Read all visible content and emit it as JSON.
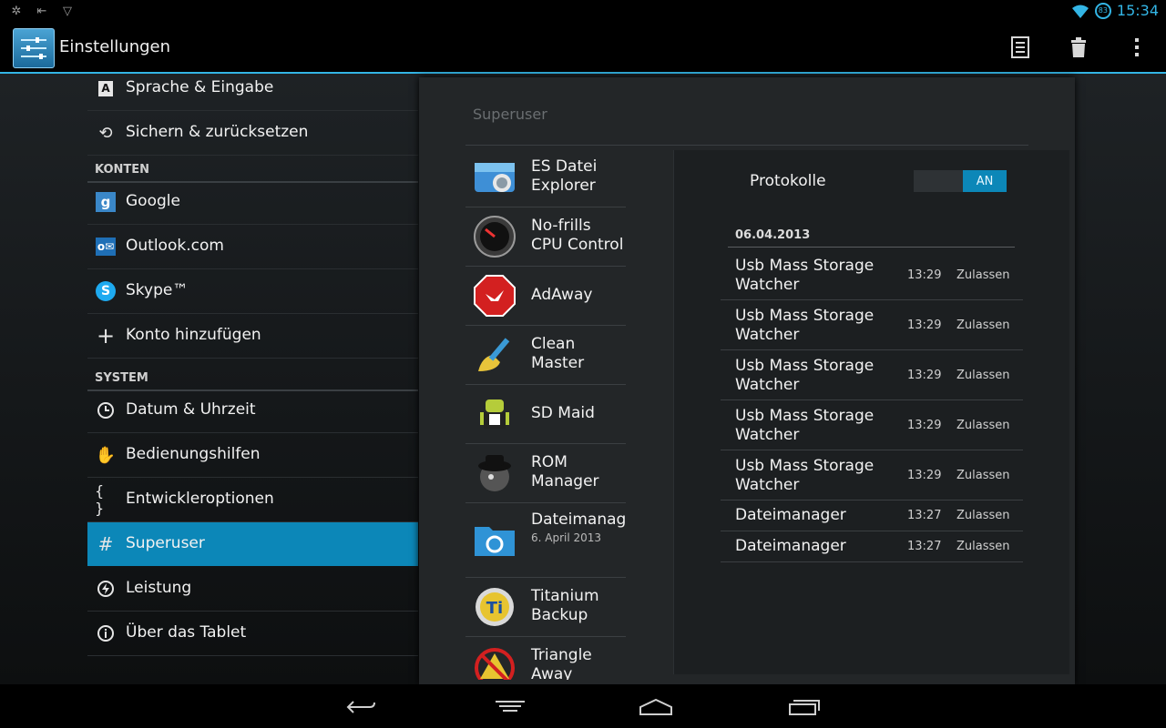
{
  "status": {
    "time": "15:34",
    "battery_label": "83"
  },
  "actionbar": {
    "title": "Einstellungen"
  },
  "settings": {
    "items": [
      {
        "label": "Sprache & Eingabe",
        "icon": "keyboard-a-icon"
      },
      {
        "label": "Sichern & zurücksetzen",
        "icon": "restore-icon"
      },
      {
        "section": "KONTEN"
      },
      {
        "label": "Google",
        "icon": "google-icon"
      },
      {
        "label": "Outlook.com",
        "icon": "outlook-icon"
      },
      {
        "label": "Skype™",
        "icon": "skype-icon"
      },
      {
        "label": "Konto hinzufügen",
        "icon": "plus-icon"
      },
      {
        "section": "SYSTEM"
      },
      {
        "label": "Datum & Uhrzeit",
        "icon": "clock-icon"
      },
      {
        "label": "Bedienungshilfen",
        "icon": "hand-icon"
      },
      {
        "label": "Entwickleroptionen",
        "icon": "braces-icon"
      },
      {
        "label": "Superuser",
        "icon": "hash-icon",
        "selected": true
      },
      {
        "label": "Leistung",
        "icon": "lightning-icon"
      },
      {
        "label": "Über das Tablet",
        "icon": "info-icon"
      }
    ]
  },
  "superuser": {
    "title": "Superuser",
    "apps": [
      {
        "name": "ES Datei Explorer",
        "sub": "",
        "icon": "es-file-explorer-icon"
      },
      {
        "name": "No-frills CPU Control",
        "sub": "",
        "icon": "cpu-gauge-icon"
      },
      {
        "name": "AdAway",
        "sub": "",
        "icon": "adaway-stop-icon"
      },
      {
        "name": "Clean Master",
        "sub": "",
        "icon": "broom-icon"
      },
      {
        "name": "SD Maid",
        "sub": "",
        "icon": "sd-maid-robot-icon"
      },
      {
        "name": "ROM Manager",
        "sub": "",
        "icon": "rom-manager-icon"
      },
      {
        "name": "Dateimanager",
        "sub": "6. April 2013",
        "icon": "folder-icon"
      },
      {
        "name": "Titanium Backup",
        "sub": "",
        "icon": "titanium-backup-icon"
      },
      {
        "name": "Triangle Away",
        "sub": "",
        "icon": "triangle-away-icon"
      }
    ],
    "detail": {
      "protokolle_label": "Protokolle",
      "toggle_label": "AN",
      "date_header": "06.04.2013",
      "logs": [
        {
          "name": "Usb Mass Storage Watcher",
          "time": "13:29",
          "action": "Zulassen"
        },
        {
          "name": "Usb Mass Storage Watcher",
          "time": "13:29",
          "action": "Zulassen"
        },
        {
          "name": "Usb Mass Storage Watcher",
          "time": "13:29",
          "action": "Zulassen"
        },
        {
          "name": "Usb Mass Storage Watcher",
          "time": "13:29",
          "action": "Zulassen"
        },
        {
          "name": "Usb Mass Storage Watcher",
          "time": "13:29",
          "action": "Zulassen"
        },
        {
          "name": "Dateimanager",
          "time": "13:27",
          "action": "Zulassen"
        },
        {
          "name": "Dateimanager",
          "time": "13:27",
          "action": "Zulassen"
        }
      ]
    }
  },
  "colors": {
    "accent": "#33b5e5",
    "selected": "#0c87b8"
  }
}
